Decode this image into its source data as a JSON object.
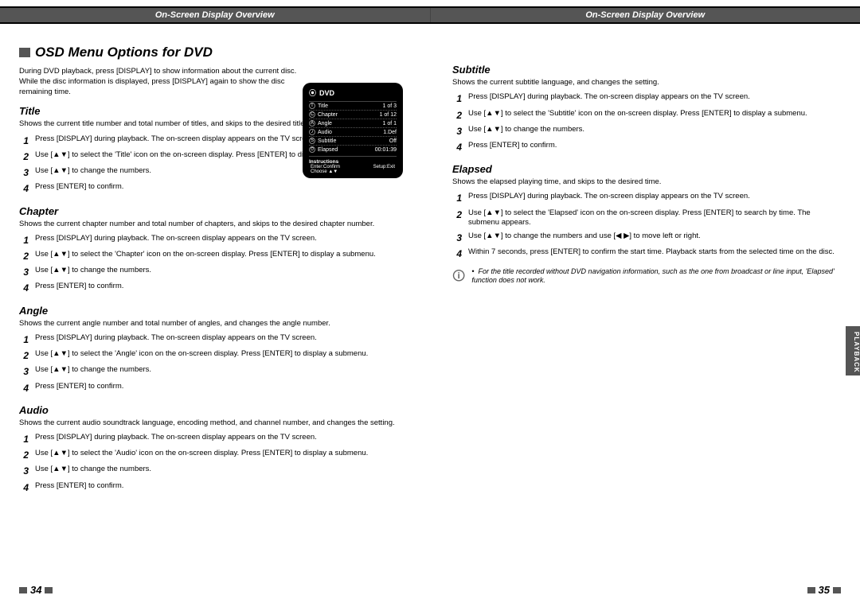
{
  "header": {
    "left": "On-Screen Display Overview",
    "right": "On-Screen Display Overview"
  },
  "main_heading": "OSD Menu Options for DVD",
  "intro": "During DVD playback, press [DISPLAY] to show information about the current disc. While the disc information is displayed, press [DISPLAY] again to show the disc remaining time.",
  "osd": {
    "label": "DVD",
    "rows": [
      {
        "icon": "T",
        "name": "Title",
        "val": "1 of 3"
      },
      {
        "icon": "C",
        "name": "Chapter",
        "val": "1 of 12"
      },
      {
        "icon": "A",
        "name": "Angle",
        "val": "1 of 1"
      },
      {
        "icon": "♪",
        "name": "Audio",
        "val": "1.Def"
      },
      {
        "icon": "S",
        "name": "Subtitle",
        "val": "Off"
      },
      {
        "icon": "⏱",
        "name": "Elapsed",
        "val": "00:01:39"
      }
    ],
    "instructions_label": "Instructions",
    "hint_enter": "Enter:Confirm",
    "hint_setup": "Setup:Exit",
    "hint_choose": "Choose   ▲▼"
  },
  "sections_left": [
    {
      "title": "Title",
      "desc": "Shows the current title number and total number of titles, and skips to the desired title number.",
      "steps": [
        "Press [DISPLAY] during playback. The on-screen display appears on the TV screen.",
        "Use [▲▼] to select the 'Title' icon on the on-screen display. Press [ENTER] to display a submenu.",
        "Use [▲▼] to change the numbers.",
        "Press [ENTER] to confirm."
      ]
    },
    {
      "title": "Chapter",
      "desc": "Shows the current chapter number and total number of chapters, and skips to the desired chapter number.",
      "steps": [
        "Press [DISPLAY] during playback. The on-screen display appears on the TV screen.",
        "Use [▲▼] to select the 'Chapter' icon on the on-screen display. Press [ENTER] to display a submenu.",
        "Use [▲▼] to change the numbers.",
        "Press [ENTER] to confirm."
      ]
    },
    {
      "title": "Angle",
      "desc": "Shows the current angle number and total number of angles, and changes the angle number.",
      "steps": [
        "Press [DISPLAY] during playback. The on-screen display appears on the TV screen.",
        "Use [▲▼] to select the 'Angle' icon on the on-screen display. Press [ENTER] to display a submenu.",
        "Use [▲▼] to change the numbers.",
        "Press [ENTER] to confirm."
      ]
    },
    {
      "title": "Audio",
      "desc": "Shows the current audio soundtrack language, encoding method, and channel number, and changes the setting.",
      "steps": [
        "Press [DISPLAY] during playback. The on-screen display appears on the TV screen.",
        "Use [▲▼] to select the 'Audio' icon on the on-screen display. Press [ENTER] to display a submenu.",
        "Use [▲▼] to change the numbers.",
        "Press [ENTER] to confirm."
      ]
    }
  ],
  "sections_right": [
    {
      "title": "Subtitle",
      "desc": "Shows the current subtitle language, and changes the setting.",
      "steps": [
        "Press [DISPLAY] during playback. The on-screen display appears on the TV screen.",
        "Use [▲▼] to select the 'Subtitle' icon on the on-screen display. Press [ENTER] to display a submenu.",
        "Use [▲▼] to change the numbers.",
        "Press [ENTER] to confirm."
      ]
    },
    {
      "title": "Elapsed",
      "desc": "Shows the elapsed playing time, and skips to the desired time.",
      "steps": [
        "Press [DISPLAY] during playback. The on-screen display appears on the TV screen.",
        "Use [▲▼] to select the 'Elapsed' icon on the on-screen display. Press [ENTER] to search by time. The submenu appears.",
        "Use [▲▼] to change the numbers and use [◀ ▶] to move left or right.",
        "Within 7 seconds, press [ENTER] to confirm the start time. Playback starts from the selected time on the disc."
      ]
    }
  ],
  "note": {
    "bullet": "•",
    "text": "For the title recorded without DVD navigation information, such as the one from broadcast or line input, 'Elapsed' function does not work."
  },
  "side_tab": "PLAYBACK",
  "pages": {
    "left": "34",
    "right": "35"
  }
}
